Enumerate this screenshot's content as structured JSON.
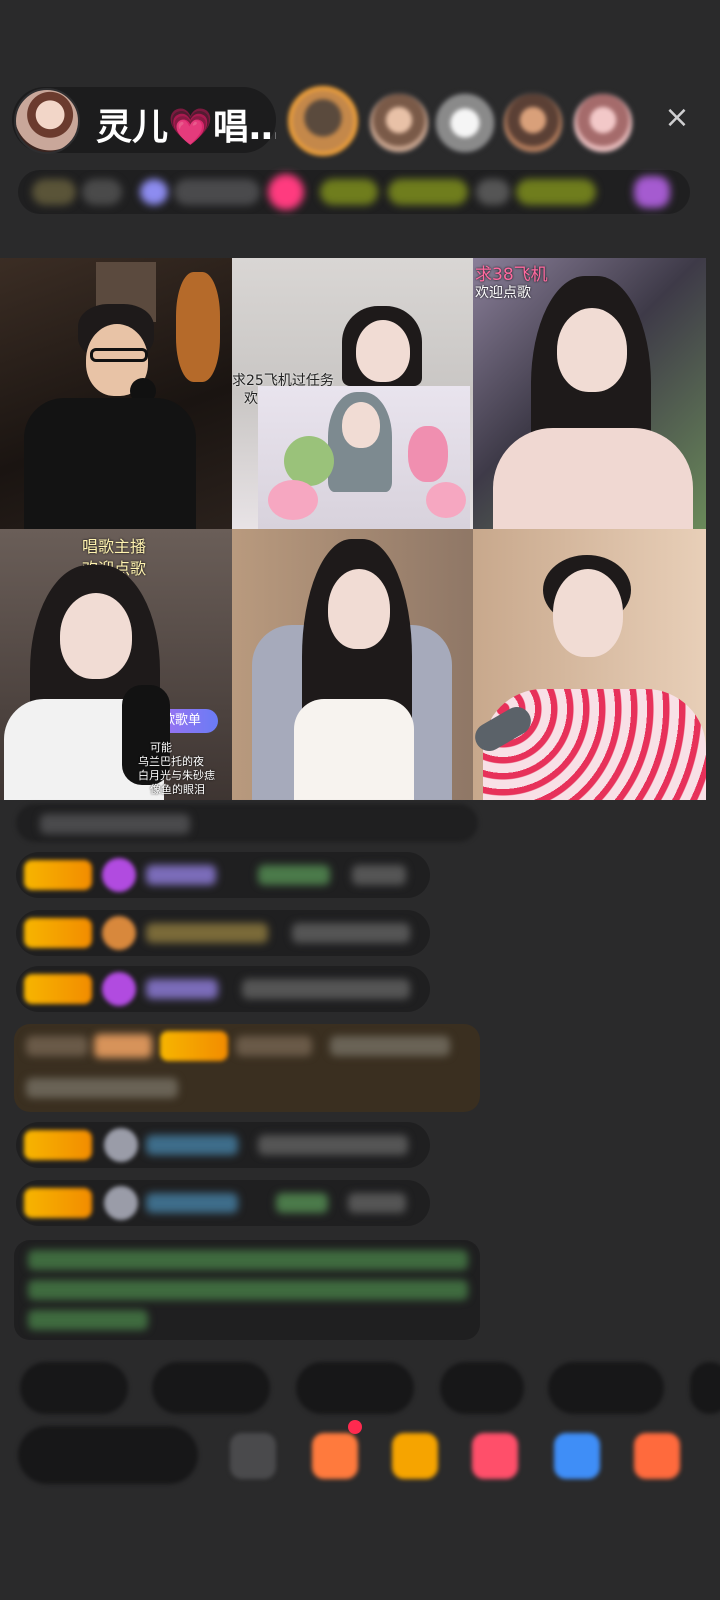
{
  "header": {
    "host_name": "灵儿💗唱…",
    "close_icon": "×"
  },
  "grid": {
    "tile3_caption": "求38飞机",
    "tile3_caption2": "欢迎点歌",
    "tile2_caption": "求25飞机过任务",
    "tile2_caption2": "欢",
    "tile4_caption": "唱歌主播",
    "tile4_caption2": "欢迎点歌",
    "tile4_badge": "唱歌歌单",
    "tile4_song1": "可能",
    "tile4_song2": "乌兰巴托的夜",
    "tile4_song3": "白月光与朱砂痣",
    "tile4_song4": "像鱼的眼泪"
  },
  "colors": {
    "accent_gold": "#f7b500",
    "pink": "#ff3b7f",
    "background": "#2a2a2b"
  }
}
